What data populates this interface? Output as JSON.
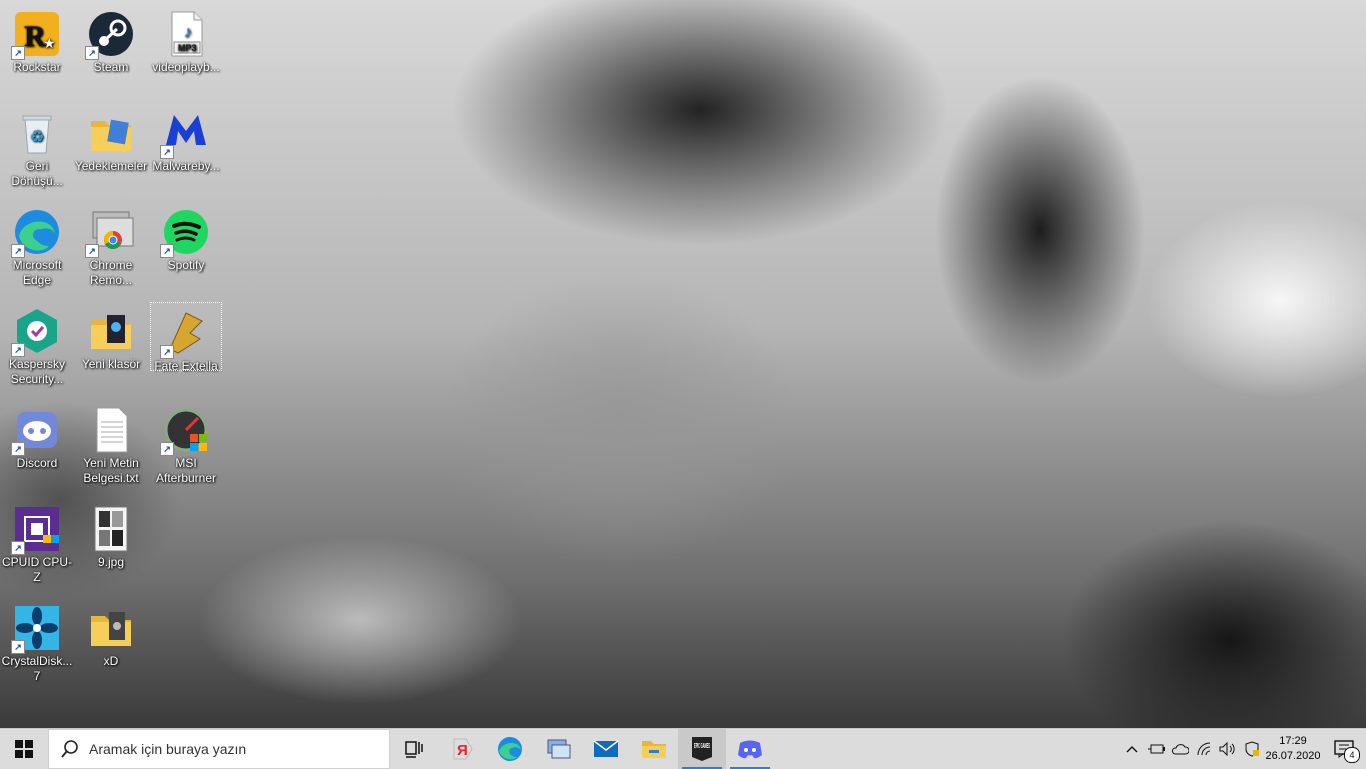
{
  "desktop_icons": [
    {
      "label": "Rockstar",
      "shortcut": true
    },
    {
      "label": "Steam",
      "shortcut": true
    },
    {
      "label": "videoplayb...",
      "shortcut": false
    },
    {
      "label": "Geri Dönüşü...",
      "shortcut": false
    },
    {
      "label": "Yedeklemeler",
      "shortcut": false
    },
    {
      "label": "Malwareby...",
      "shortcut": true
    },
    {
      "label": "Microsoft Edge",
      "shortcut": true
    },
    {
      "label": "Chrome Remo...",
      "shortcut": true
    },
    {
      "label": "Spotify",
      "shortcut": true
    },
    {
      "label": "Kaspersky Security...",
      "shortcut": true
    },
    {
      "label": "Yeni klasör",
      "shortcut": false
    },
    {
      "label": "Fate Extella",
      "shortcut": true
    },
    {
      "label": "Discord",
      "shortcut": true
    },
    {
      "label": "Yeni Metin Belgesi.txt",
      "shortcut": false
    },
    {
      "label": "MSI Afterburner",
      "shortcut": true
    },
    {
      "label": "CPUID CPU-Z",
      "shortcut": true
    },
    {
      "label": "9.jpg",
      "shortcut": false
    },
    {
      "label": "CrystalDisk... 7",
      "shortcut": true
    },
    {
      "label": "xD",
      "shortcut": false
    }
  ],
  "mp3_badge": "MP3",
  "taskbar": {
    "search_placeholder": "Aramak için buraya yazın",
    "epic_label": "EPIC GAMES",
    "clock_time": "17:29",
    "clock_date": "26.07.2020",
    "notification_count": "4"
  },
  "colors": {
    "accent": "#2a7fd4",
    "taskbar_bg": "#dcdcdc",
    "rockstar": "#f2b01e",
    "spotify": "#1ed760",
    "discord": "#5865f2"
  }
}
